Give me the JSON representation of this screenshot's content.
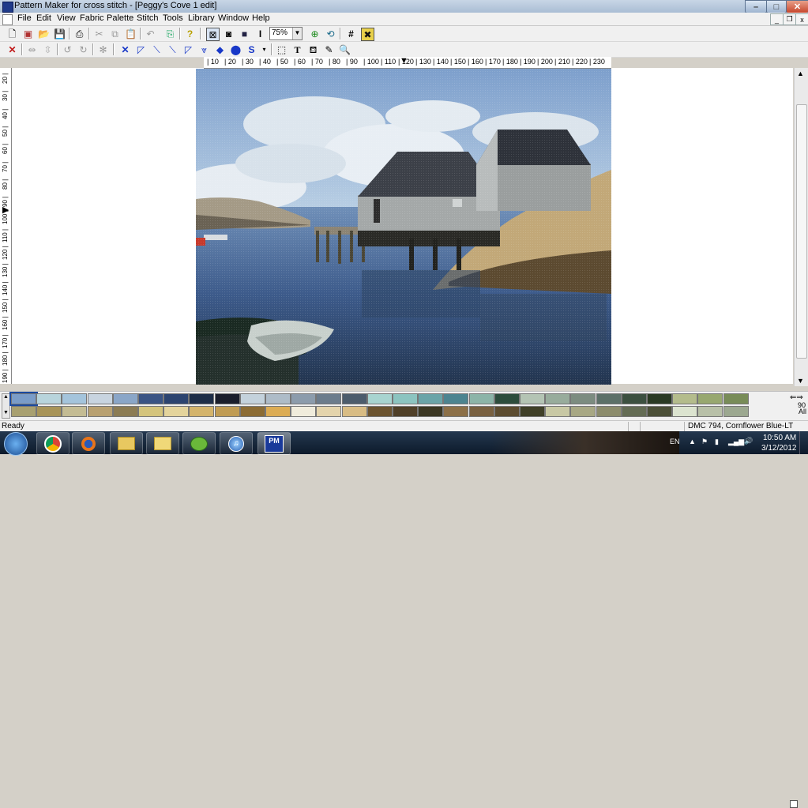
{
  "window": {
    "title": "Pattern Maker for cross stitch - [Peggy's Cove 1 edit]"
  },
  "menu": [
    "File",
    "Edit",
    "View",
    "Fabric",
    "Palette",
    "Stitch",
    "Tools",
    "Library",
    "Window",
    "Help"
  ],
  "toolbar": {
    "zoom": "75%"
  },
  "ruler": {
    "h": [
      "10",
      "20",
      "30",
      "40",
      "50",
      "60",
      "70",
      "80",
      "90",
      "100",
      "110",
      "120",
      "130",
      "140",
      "150",
      "160",
      "170",
      "180",
      "190",
      "200",
      "210",
      "220",
      "230"
    ],
    "v": [
      "20",
      "30",
      "40",
      "50",
      "60",
      "70",
      "80",
      "90",
      "100",
      "110",
      "120",
      "130",
      "140",
      "150",
      "160",
      "170",
      "180",
      "190"
    ]
  },
  "palette": {
    "row1": [
      "#7a9cc8",
      "#b8d4dc",
      "#a4c4dc",
      "#c8d4e0",
      "#8aa6c8",
      "#3a5484",
      "#2c4470",
      "#1e2e48",
      "#1a1e2c",
      "#c4d2dc",
      "#aebcc8",
      "#8c9cac",
      "#6c7c8c",
      "#4c5c6c",
      "#a8d4d0",
      "#8cc4c0",
      "#6aa4a8",
      "#4c8490",
      "#8cb4a8",
      "#2c4c3c",
      "#b4c4b4",
      "#98ac9c",
      "#7c8c80",
      "#5c7068",
      "#3c5040",
      "#2a3a24",
      "#b4bc8c",
      "#98a870",
      "#788c58"
    ],
    "row2": [
      "#a8a070",
      "#a89458",
      "#c4bc94",
      "#b8a070",
      "#8c7c54",
      "#d4c47c",
      "#e4d49c",
      "#d4b46c",
      "#c09c54",
      "#8c6c34",
      "#dcac54",
      "#f0ecdc",
      "#e4d4ac",
      "#d8bc84",
      "#6c5430",
      "#504028",
      "#3c3824",
      "#8c7048",
      "#786040",
      "#5c4c30",
      "#404028",
      "#c8c8a4",
      "#a8a884",
      "#8c8c6c",
      "#646c54",
      "#4c5038",
      "#dce4d0",
      "#b8c0a8",
      "#9ca890"
    ]
  },
  "side": {
    "count": "90",
    "all_label": "All"
  },
  "status": {
    "text": "Ready",
    "color": "DMC  794, Cornflower Blue-LT"
  },
  "taskbar": {
    "lang": "EN",
    "time": "10:50 AM",
    "date": "3/12/2012"
  }
}
